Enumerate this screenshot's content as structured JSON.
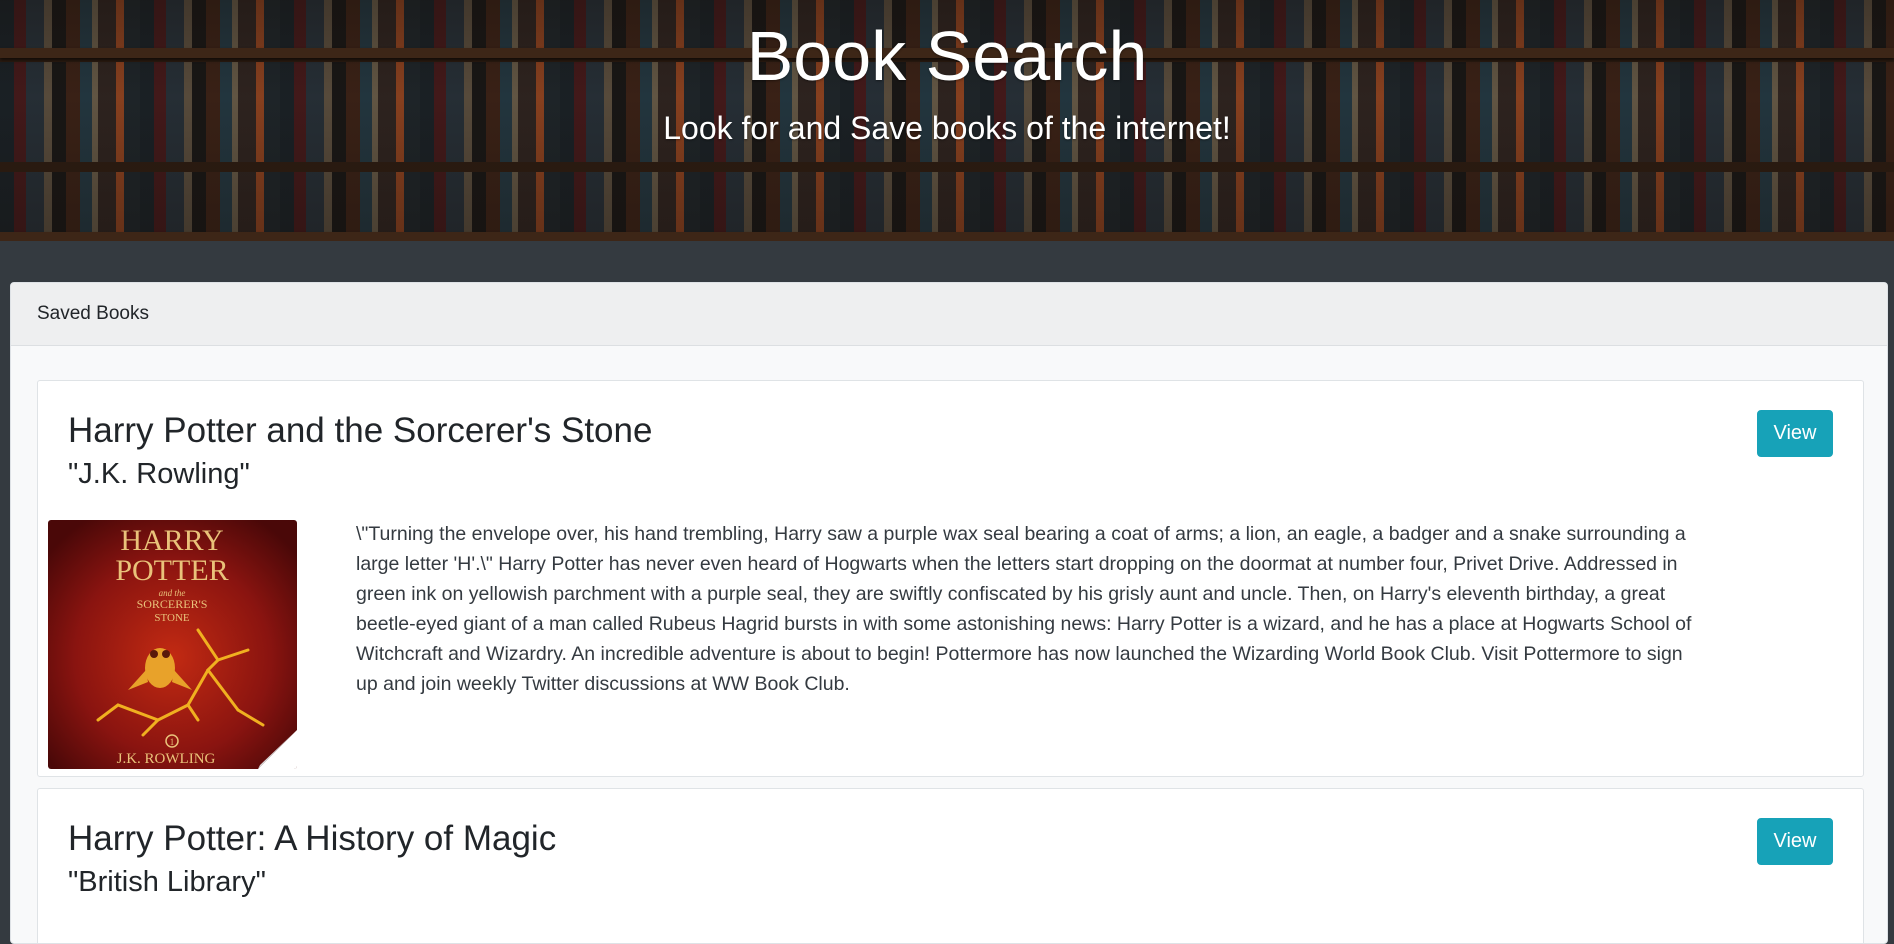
{
  "hero": {
    "title": "Book Search",
    "subtitle": "Look for and Save books of the internet!"
  },
  "saved_books": {
    "header": "Saved Books",
    "books": [
      {
        "title": "Harry Potter and the Sorcerer's Stone",
        "author": "\"J.K. Rowling\"",
        "view_label": "View",
        "cover": {
          "line1": "HARRY",
          "line2": "POTTER",
          "line3": "and the",
          "line4": "SORCERER'S",
          "line5": "STONE",
          "number": "1",
          "author": "J.K. ROWLING"
        },
        "description": "\\\"Turning the envelope over, his hand trembling, Harry saw a purple wax seal bearing a coat of arms; a lion, an eagle, a badger and a snake surrounding a large letter 'H'.\\\" Harry Potter has never even heard of Hogwarts when the letters start dropping on the doormat at number four, Privet Drive. Addressed in green ink on yellowish parchment with a purple seal, they are swiftly confiscated by his grisly aunt and uncle. Then, on Harry's eleventh birthday, a great beetle-eyed giant of a man called Rubeus Hagrid bursts in with some astonishing news: Harry Potter is a wizard, and he has a place at Hogwarts School of Witchcraft and Wizardry. An incredible adventure is about to begin! Pottermore has now launched the Wizarding World Book Club. Visit Pottermore to sign up and join weekly Twitter discussions at WW Book Club."
      },
      {
        "title": "Harry Potter: A History of Magic",
        "author": "\"British Library\"",
        "view_label": "View"
      }
    ]
  },
  "colors": {
    "accent": "#17a2b8",
    "page_background": "#343a40"
  }
}
